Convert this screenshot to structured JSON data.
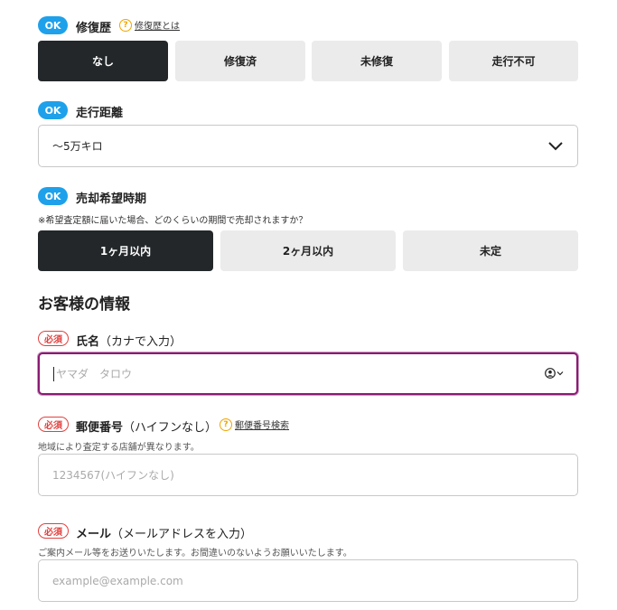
{
  "repair_history": {
    "status": "OK",
    "label": "修復歴",
    "help_link": "修復歴とは",
    "options": [
      "なし",
      "修復済",
      "未修復",
      "走行不可"
    ],
    "selected": "なし"
  },
  "mileage": {
    "status": "OK",
    "label": "走行距離",
    "selected_value": "〜5万キロ"
  },
  "sale_timing": {
    "status": "OK",
    "label": "売却希望時期",
    "note": "※希望査定額に届いた場合、どのくらいの期間で売却されますか？",
    "options": [
      "1ヶ月以内",
      "2ヶ月以内",
      "未定"
    ],
    "selected": "1ヶ月以内"
  },
  "customer_section": {
    "title": "お客様の情報"
  },
  "name_field": {
    "required": "必須",
    "label": "氏名",
    "sub_label": "（カナで入力）",
    "placeholder": "ヤマダ　タロウ"
  },
  "postal_field": {
    "required": "必須",
    "label": "郵便番号",
    "sub_label": "（ハイフンなし）",
    "help_link": "郵便番号検索",
    "note": "地域により査定する店舗が異なります。",
    "placeholder": "1234567(ハイフンなし)"
  },
  "email_field": {
    "required": "必須",
    "label": "メール",
    "sub_label": "（メールアドレスを入力）",
    "note": "ご案内メール等をお送りいたします。お間違いのないようお願いいたします。",
    "placeholder": "example@example.com"
  },
  "colors": {
    "ok_badge": "#1ea1ea",
    "required": "#e0413f",
    "selected_segment": "#23272a",
    "focus_border": "#8a1a73",
    "help_icon": "#f0a500"
  }
}
